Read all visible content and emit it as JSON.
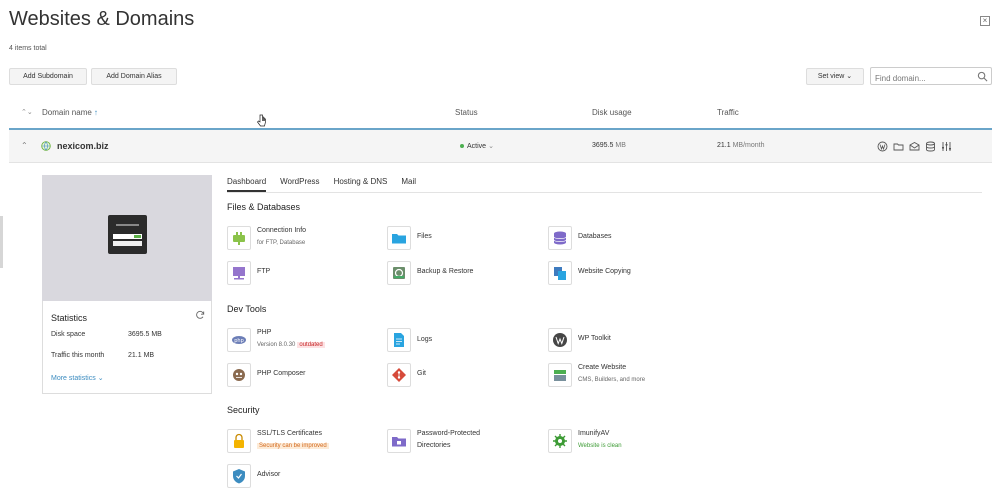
{
  "header": {
    "title": "Websites & Domains",
    "items_total": "4 items total"
  },
  "toolbar": {
    "add_subdomain": "Add Subdomain",
    "add_domain_alias": "Add Domain Alias",
    "set_view": "Set view",
    "search_placeholder": "Find domain..."
  },
  "table": {
    "columns": {
      "domain": "Domain name",
      "status": "Status",
      "disk": "Disk usage",
      "traffic": "Traffic"
    },
    "rows": [
      {
        "domain": "nexicom.biz",
        "status": "Active",
        "disk_value": "3695.5",
        "disk_unit": "MB",
        "traffic_value": "21.1",
        "traffic_unit": "MB/month"
      }
    ]
  },
  "row_actions": [
    "wordpress-icon",
    "folder-icon",
    "mail-icon",
    "database-icon",
    "settings-sliders-icon"
  ],
  "stats": {
    "title": "Statistics",
    "disk_label": "Disk space",
    "disk_value": "3695.5 MB",
    "traffic_label": "Traffic this month",
    "traffic_value": "21.1 MB",
    "more": "More statistics"
  },
  "tabs": [
    "Dashboard",
    "WordPress",
    "Hosting & DNS",
    "Mail"
  ],
  "sections": {
    "files": {
      "title": "Files & Databases",
      "connection_info": "Connection Info",
      "connection_info_sub": "for FTP, Database",
      "files": "Files",
      "databases": "Databases",
      "ftp": "FTP",
      "backup": "Backup & Restore",
      "website_copying": "Website Copying"
    },
    "dev": {
      "title": "Dev Tools",
      "php": "PHP",
      "php_version": "Version 8.0.30",
      "php_badge": "outdated",
      "logs": "Logs",
      "wp_toolkit": "WP Toolkit",
      "php_composer": "PHP Composer",
      "git": "Git",
      "create_website": "Create Website",
      "create_website_sub": "CMS, Builders, and more"
    },
    "security": {
      "title": "Security",
      "ssl": "SSL/TLS Certificates",
      "ssl_badge": "Security can be improved",
      "pwd_line1": "Password-Protected",
      "pwd_line2": "Directories",
      "imunify": "ImunifyAV",
      "imunify_status": "Website is clean",
      "advisor": "Advisor"
    }
  },
  "colors": {
    "accent": "#3c8cc0",
    "active": "#4caf50",
    "header_border": "#6aa5c9"
  }
}
